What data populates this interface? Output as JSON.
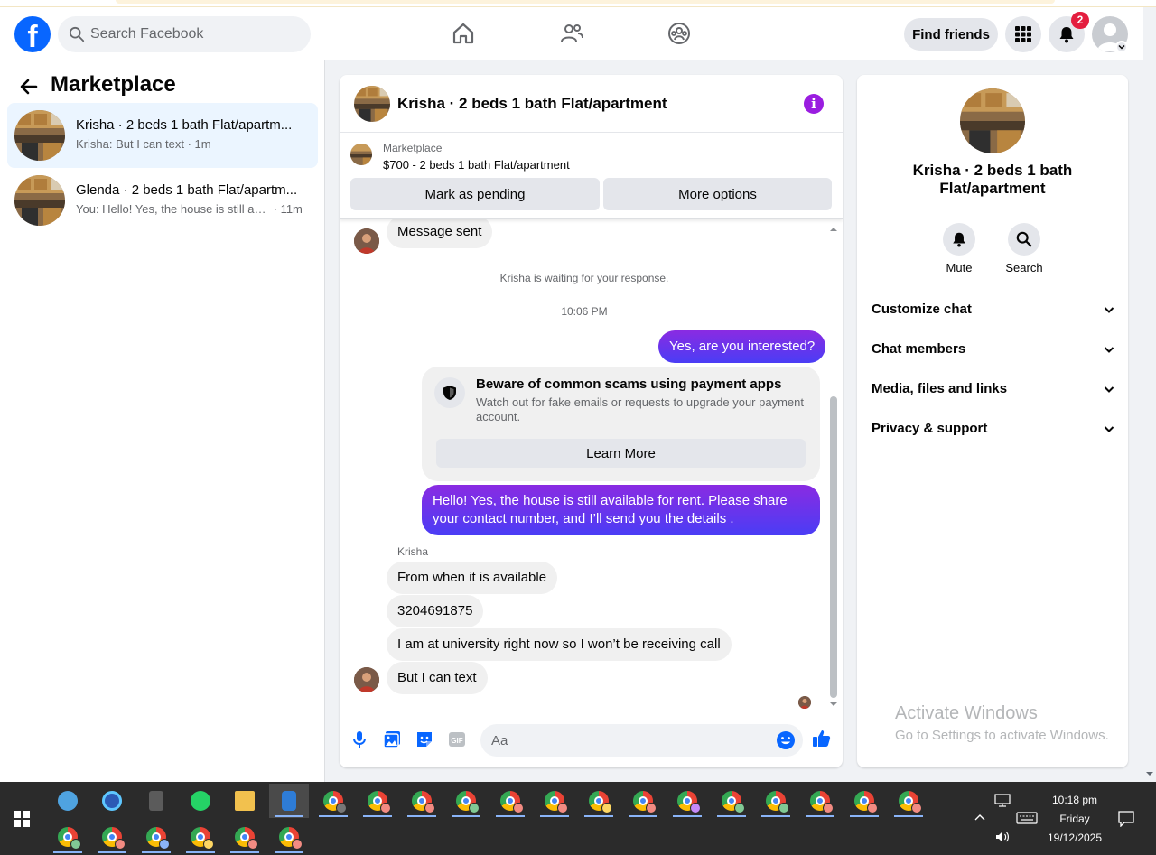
{
  "header": {
    "search_placeholder": "Search Facebook",
    "find_friends_label": "Find friends",
    "notification_count": "2"
  },
  "sidebar": {
    "title": "Marketplace",
    "conversations": [
      {
        "title": "Krisha · 2 beds 1 bath Flat/apartm...",
        "preview": "Krisha: But I can text",
        "time": "1m",
        "active": true
      },
      {
        "title": "Glenda · 2 beds 1 bath Flat/apartm...",
        "preview": "You: Hello! Yes, the house is still avai...",
        "time": "11m",
        "active": false
      }
    ]
  },
  "chat": {
    "title": "Krisha · 2 beds 1 bath Flat/apartment",
    "listing": {
      "label": "Marketplace",
      "price_title": "$700 - 2 beds 1 bath Flat/apartment",
      "mark_pending_label": "Mark as pending",
      "more_options_label": "More options"
    },
    "messages": {
      "message_sent": "Message sent",
      "waiting": "Krisha is waiting for your response.",
      "timestamp": "10:06 PM",
      "out_1": "Yes, are you interested?",
      "scam_title": "Beware of common scams using payment apps",
      "scam_body": "Watch out for fake emails or requests to upgrade your payment account.",
      "learn_more": "Learn More",
      "out_2": "Hello! Yes, the house is still available for rent. Please share your contact number, and I’ll send you the details .",
      "sender_name": "Krisha",
      "in_1": "From when it is available",
      "in_2": "3204691875",
      "in_3": "I am at university right now so I won’t be receiving call",
      "in_4": "But I can text"
    },
    "composer_placeholder": "Aa"
  },
  "details": {
    "title": "Krisha · 2 beds 1 bath Flat/apartment",
    "mute_label": "Mute",
    "search_label": "Search",
    "sections": [
      "Customize chat",
      "Chat members",
      "Media, files and links",
      "Privacy & support"
    ]
  },
  "watermark": {
    "line1": "Activate Windows",
    "line2": "Go to Settings to activate Windows."
  },
  "taskbar": {
    "time": "10:18 pm",
    "day": "Friday",
    "date": "19/12/2025"
  },
  "colors": {
    "facebook_blue": "#0866ff",
    "outgoing_gradient_top": "#8a2be2",
    "outgoing_gradient_bottom": "#4a3df5",
    "info_purple": "#9a1de0",
    "badge_red": "#e41e3f"
  }
}
